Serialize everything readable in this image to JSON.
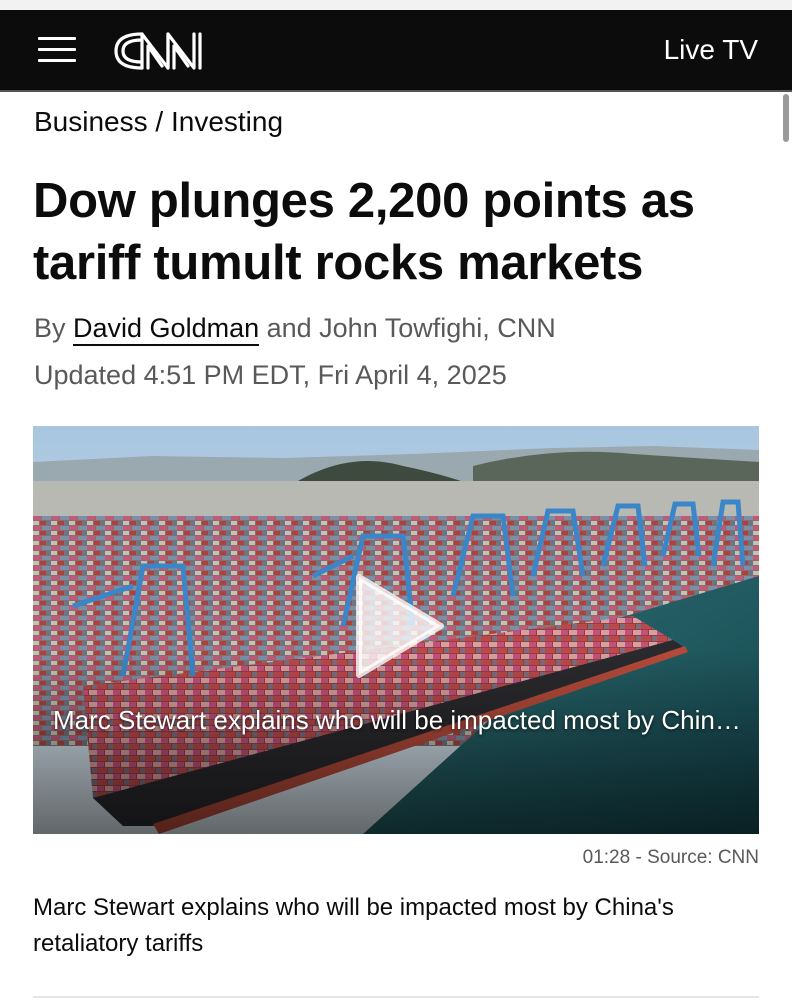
{
  "header": {
    "menu_icon": "hamburger-menu-icon",
    "logo_text": "CNN",
    "live_tv_label": "Live TV",
    "background_color": "#0c0c0c"
  },
  "breadcrumb": {
    "section": "Business",
    "separator": " / ",
    "subsection": "Investing"
  },
  "article": {
    "headline": "Dow plunges 2,200 points as tariff tumult rocks markets",
    "byline_prefix": "By ",
    "author_primary": "David Goldman",
    "author_rest": " and John Towfighi, CNN",
    "timestamp": "Updated 4:51 PM EDT, Fri April 4, 2025"
  },
  "video": {
    "play_icon": "play-icon",
    "overlay_caption": "Marc Stewart explains who will be impacted most by China's retaliatory tariffs",
    "duration": "01:28",
    "meta_separator": " - ",
    "source": "Source: CNN",
    "description": "Marc Stewart explains who will be impacted most by China's retaliatory tariffs"
  }
}
